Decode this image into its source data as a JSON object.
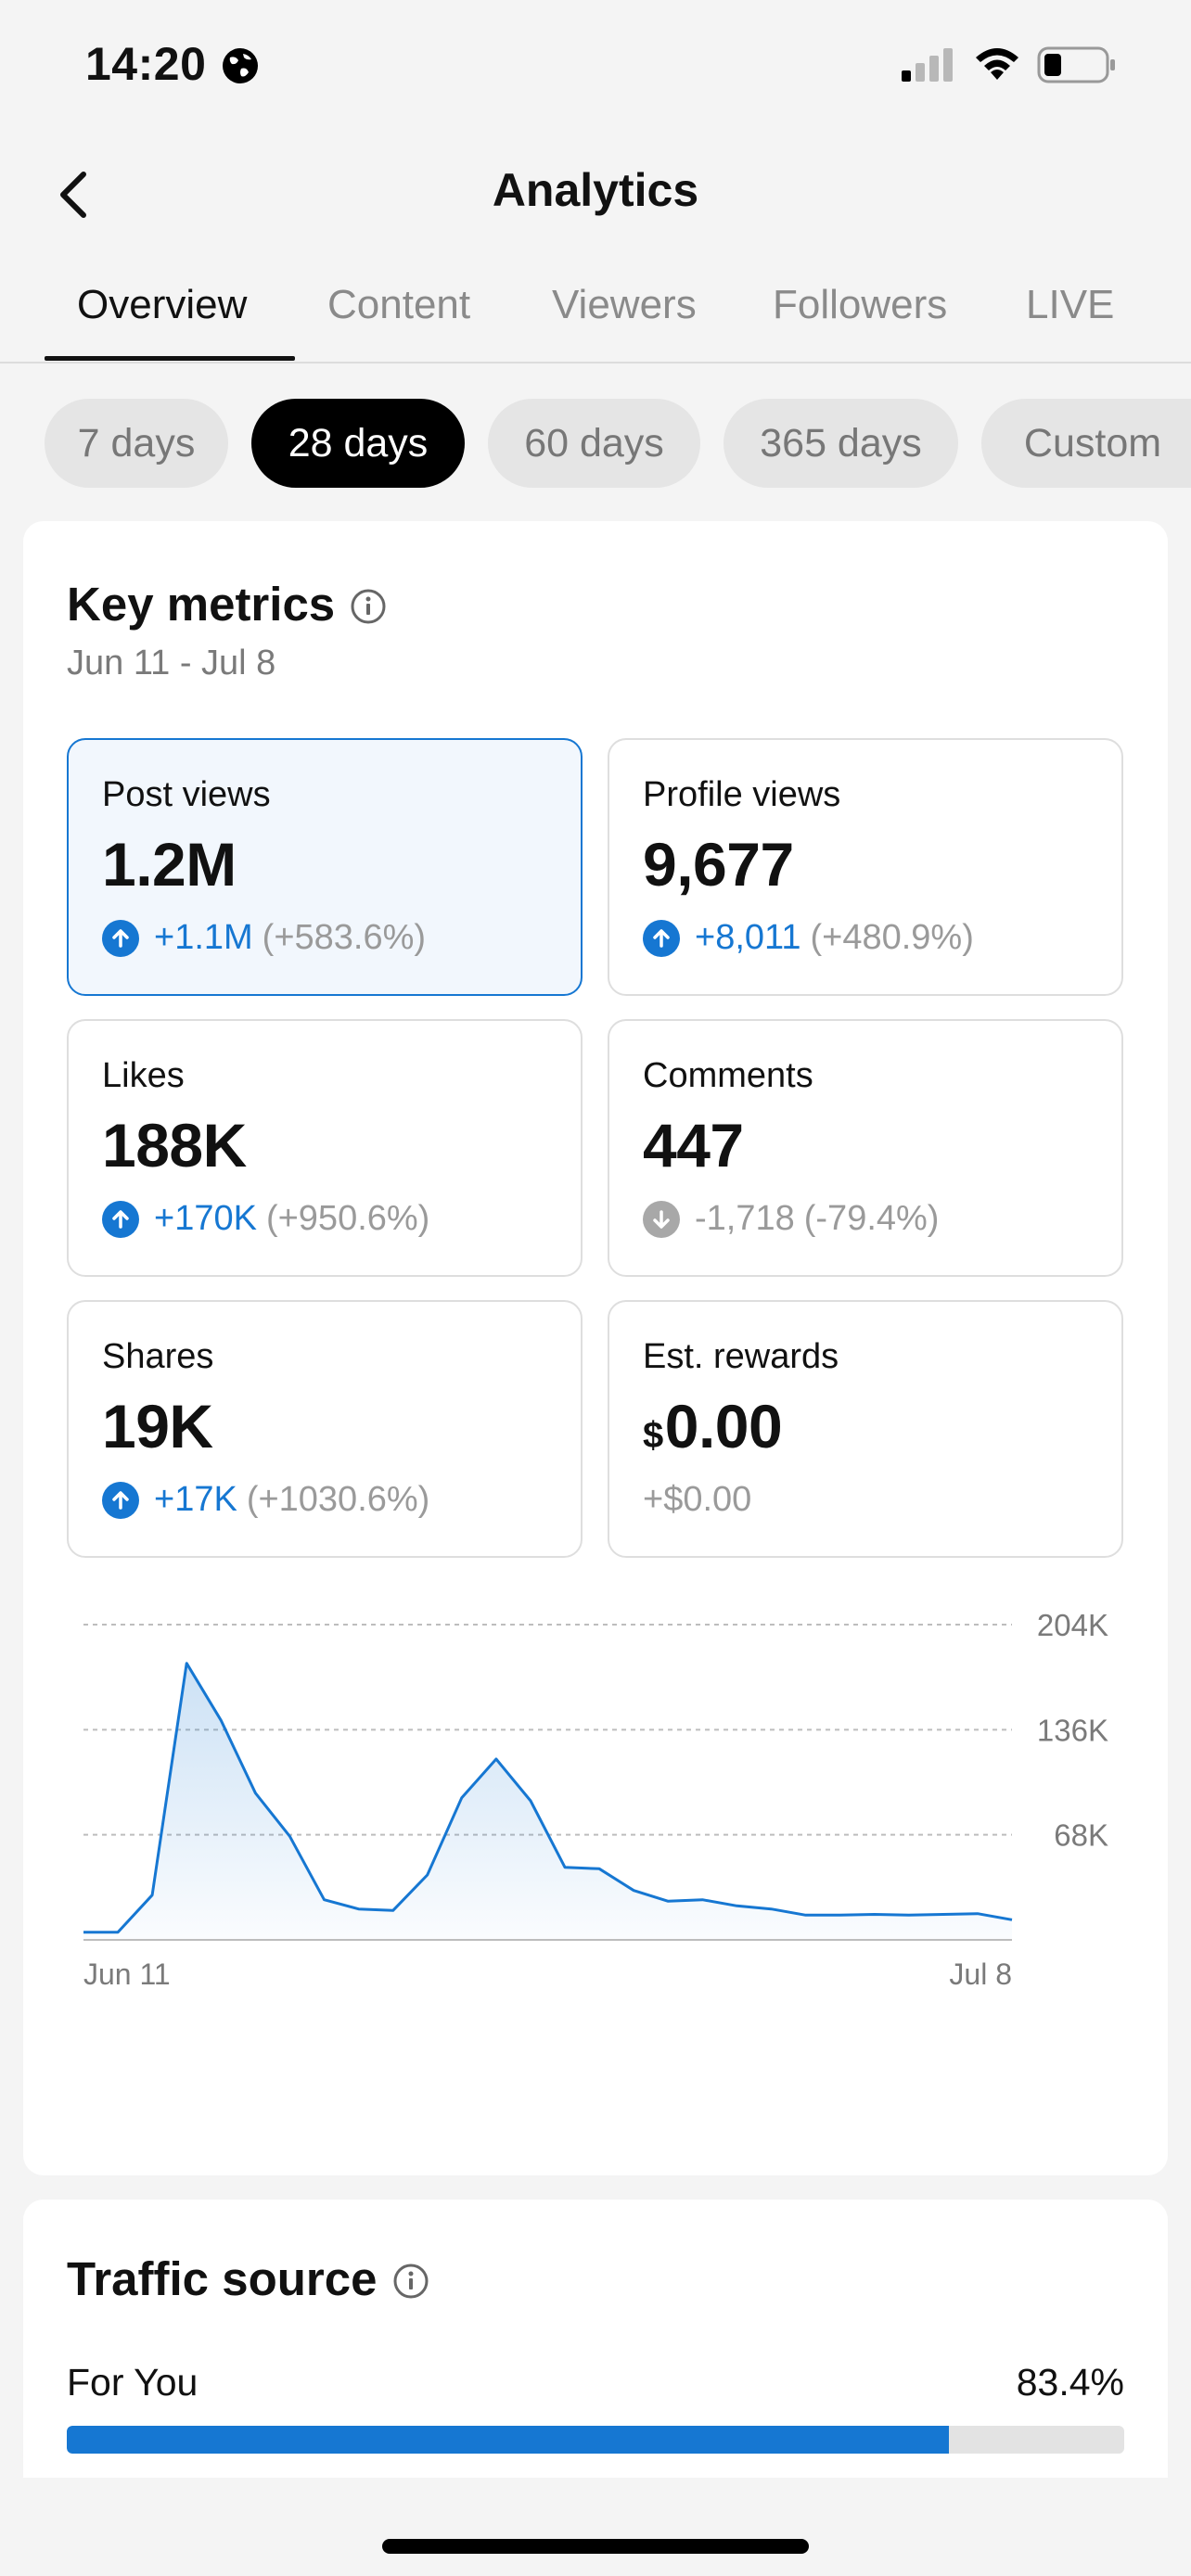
{
  "status_bar": {
    "time": "14:20",
    "icons": [
      "globe-icon",
      "signal-icon",
      "wifi-icon",
      "battery-icon"
    ]
  },
  "header": {
    "title": "Analytics",
    "back_icon": "chevron-left-icon"
  },
  "tabs": [
    {
      "label": "Overview",
      "active": true
    },
    {
      "label": "Content",
      "active": false
    },
    {
      "label": "Viewers",
      "active": false
    },
    {
      "label": "Followers",
      "active": false
    },
    {
      "label": "LIVE",
      "active": false
    }
  ],
  "day_filters": [
    {
      "label": "7 days",
      "active": false
    },
    {
      "label": "28 days",
      "active": true
    },
    {
      "label": "60 days",
      "active": false
    },
    {
      "label": "365 days",
      "active": false
    },
    {
      "label": "Custom",
      "active": false
    }
  ],
  "key_metrics": {
    "title": "Key metrics",
    "date_range": "Jun 11 - Jul 8",
    "metrics": [
      {
        "label": "Post views",
        "value": "1.2M",
        "delta": "+1.1M",
        "pct": "(+583.6%)",
        "direction": "up",
        "selected": true
      },
      {
        "label": "Profile views",
        "value": "9,677",
        "delta": "+8,011",
        "pct": "(+480.9%)",
        "direction": "up",
        "selected": false
      },
      {
        "label": "Likes",
        "value": "188K",
        "delta": "+170K",
        "pct": "(+950.6%)",
        "direction": "up",
        "selected": false
      },
      {
        "label": "Comments",
        "value": "447",
        "delta": "-1,718",
        "pct": "(-79.4%)",
        "direction": "down",
        "selected": false
      },
      {
        "label": "Shares",
        "value": "19K",
        "delta": "+17K",
        "pct": "(+1030.6%)",
        "direction": "up",
        "selected": false
      },
      {
        "label": "Est. rewards",
        "currency": "$",
        "value": "0.00",
        "delta": "+$0.00",
        "pct": "",
        "direction": "none",
        "selected": false
      }
    ]
  },
  "chart_data": {
    "type": "area",
    "x_start_label": "Jun 11",
    "x_end_label": "Jul 8",
    "y_ticks": [
      "68K",
      "136K",
      "204K"
    ],
    "y_tick_values": [
      68000,
      136000,
      204000
    ],
    "ylim": [
      0,
      204000
    ],
    "grid": true,
    "values": [
      5000,
      5000,
      29000,
      179000,
      142000,
      95000,
      67000,
      26000,
      20000,
      19000,
      42000,
      92000,
      117000,
      90000,
      47000,
      46000,
      32000,
      25000,
      26000,
      22000,
      20000,
      16000,
      16000,
      16500,
      16000,
      16500,
      17000,
      13000
    ],
    "color": "#1677d2"
  },
  "traffic_source": {
    "title": "Traffic source",
    "rows": [
      {
        "label": "For You",
        "value": "83.4%",
        "fraction": 0.834
      }
    ]
  },
  "colors": {
    "accent": "#1677d2",
    "background": "#f4f4f4",
    "card": "#ffffff"
  }
}
